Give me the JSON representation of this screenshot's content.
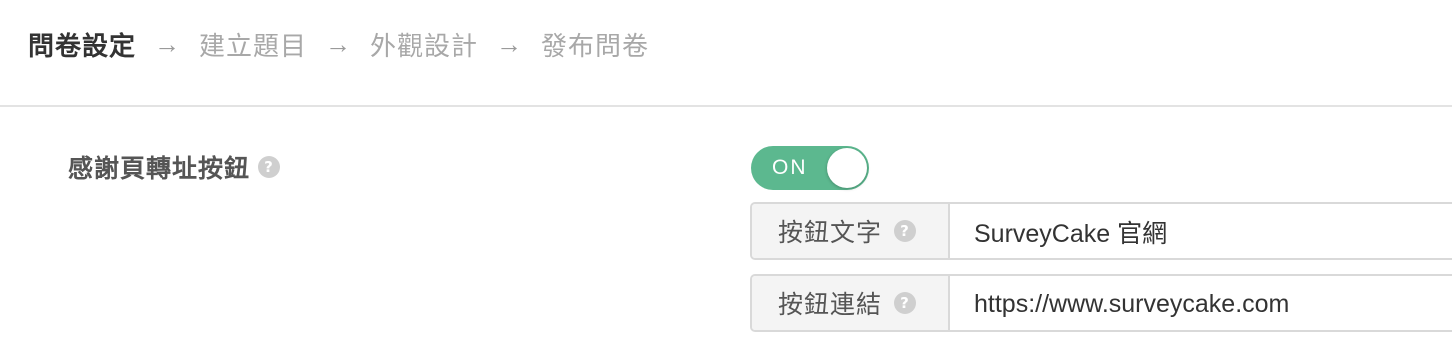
{
  "steps": {
    "items": [
      {
        "label": "問卷設定"
      },
      {
        "label": "建立題目"
      },
      {
        "label": "外觀設計"
      },
      {
        "label": "發布問卷"
      }
    ],
    "arrow": "→"
  },
  "setting": {
    "label": "感謝頁轉址按鈕",
    "help_glyph": "?"
  },
  "toggle": {
    "label": "ON",
    "state": "on",
    "color": "#5cb88f"
  },
  "button_text": {
    "label": "按鈕文字",
    "value": "SurveyCake 官網"
  },
  "button_link": {
    "label": "按鈕連結",
    "value": "https://www.surveycake.com"
  }
}
